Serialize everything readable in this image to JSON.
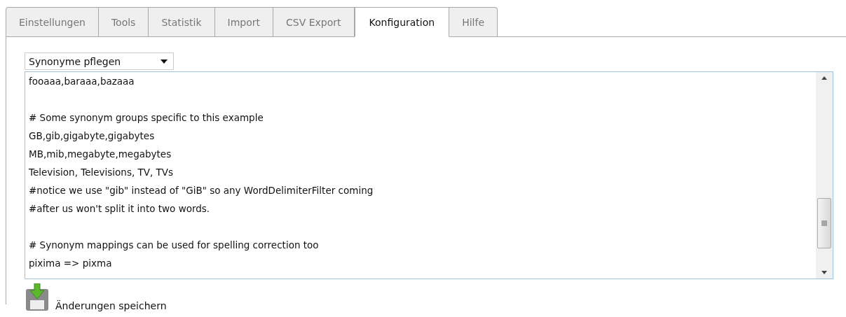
{
  "tabs": [
    {
      "label": "Einstellungen",
      "selected": false
    },
    {
      "label": "Tools",
      "selected": false
    },
    {
      "label": "Statistik",
      "selected": false
    },
    {
      "label": "Import",
      "selected": false
    },
    {
      "label": "CSV Export",
      "selected": false
    },
    {
      "label": "Konfiguration",
      "selected": true
    },
    {
      "label": "Hilfe",
      "selected": false
    }
  ],
  "dropdown": {
    "value": "Synonyme pflegen"
  },
  "editor": {
    "value": "fooaaa,baraaa,bazaaa\n\n# Some synonym groups specific to this example\nGB,gib,gigabyte,gigabytes\nMB,mib,megabyte,megabytes\nTelevision, Televisions, TV, TVs\n#notice we use \"gib\" instead of \"GiB\" so any WordDelimiterFilter coming\n#after us won't split it into two words.\n\n# Synonym mappings can be used for spelling correction too\npixima => pixma"
  },
  "save_button": {
    "label": "Änderungen speichern"
  }
}
